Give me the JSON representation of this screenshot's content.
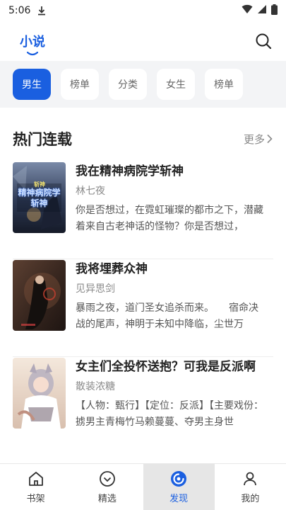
{
  "status_bar": {
    "time": "5:06"
  },
  "header": {
    "active_tab": "小说"
  },
  "filters": [
    "男生",
    "榜单",
    "分类",
    "女生",
    "榜单"
  ],
  "section": {
    "title": "热门连载",
    "more": "更多"
  },
  "books": [
    {
      "title": "我在精神病院学斩神",
      "author": "林七夜",
      "desc": "你是否想过，在霓虹璀璨的都市之下，潜藏着来自古老神话的怪物？你是否想过，",
      "cover_text": "精神病院学斩神",
      "cover_badge": "斩神",
      "cover_color": "#3a4a66"
    },
    {
      "title": "我将埋葬众神",
      "author": "见异思剑",
      "desc": "暴雨之夜，道门圣女追杀而来。　　宿命决战的尾声，神明于未知中降临，尘世万",
      "cover_color": "#3a2a22"
    },
    {
      "title": "女主们全投怀送抱？可我是反派啊",
      "author": "散装浓糖",
      "desc": "【人物：甄行】【定位：反派】【主要戏份：掳男主青梅竹马赖蔓蔓、夺男主身世",
      "cover_color": "#e9d8c8"
    }
  ],
  "nav": [
    {
      "label": "书架",
      "icon": "bookshelf-icon"
    },
    {
      "label": "精选",
      "icon": "featured-icon"
    },
    {
      "label": "发现",
      "icon": "discover-icon",
      "active": true
    },
    {
      "label": "我的",
      "icon": "profile-icon"
    }
  ],
  "colors": {
    "accent": "#1a5fe0",
    "filter_bg": "#f3f4f6"
  }
}
